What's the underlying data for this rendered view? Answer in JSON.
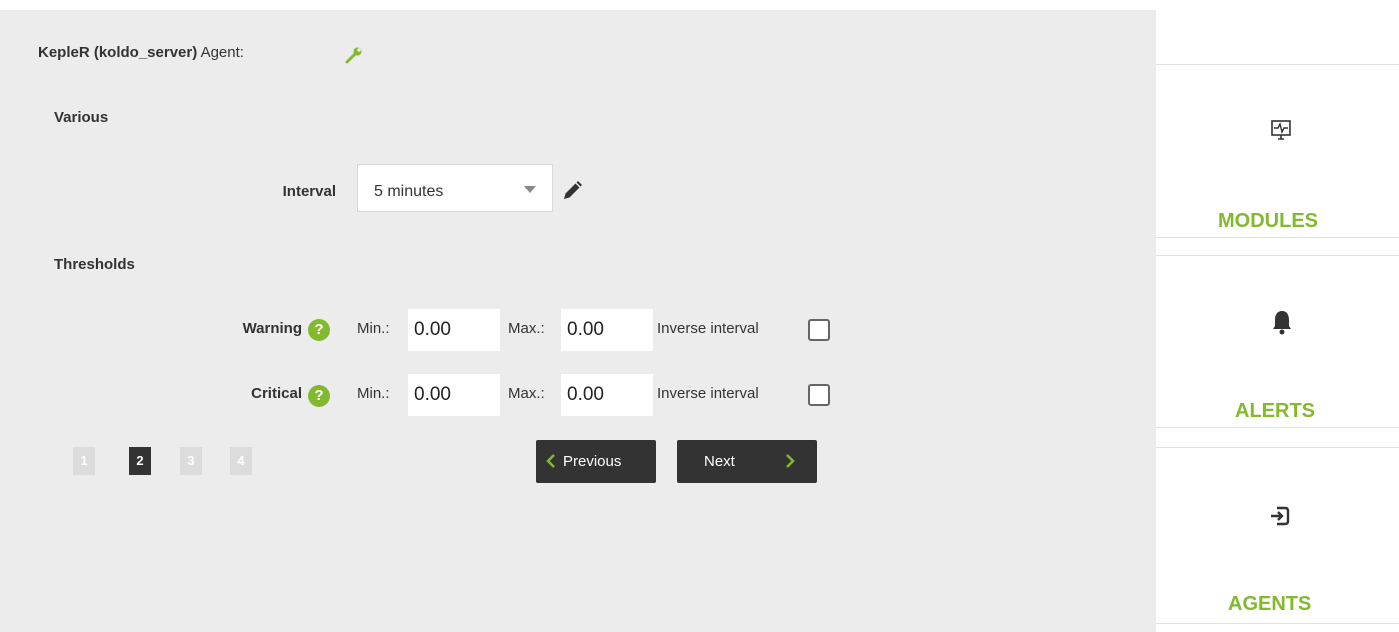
{
  "header": {
    "agent_name": "KepleR (koldo_server)",
    "agent_label": "Agent:"
  },
  "various": {
    "heading": "Various",
    "interval_label": "Interval",
    "interval_value": "5 minutes"
  },
  "thresholds": {
    "heading": "Thresholds",
    "help_glyph": "?",
    "min_label": "Min.:",
    "max_label": "Max.:",
    "inverse_label": "Inverse interval",
    "warning": {
      "label": "Warning",
      "min": "0.00",
      "max": "0.00",
      "inverse": false
    },
    "critical": {
      "label": "Critical",
      "min": "0.00",
      "max": "0.00",
      "inverse": false
    }
  },
  "pagination": {
    "pages": [
      "1",
      "2",
      "3",
      "4"
    ],
    "current": "2"
  },
  "buttons": {
    "previous": "Previous",
    "next": "Next"
  },
  "sidebar": {
    "modules": {
      "label": "MODULES",
      "icon": "monitor-icon"
    },
    "alerts": {
      "label": "ALERTS",
      "icon": "bell-icon"
    },
    "agents": {
      "label": "AGENTS",
      "icon": "login-icon"
    }
  },
  "colors": {
    "accent": "#82b92e",
    "dark_button": "#333333",
    "panel_bg": "#ececec"
  }
}
